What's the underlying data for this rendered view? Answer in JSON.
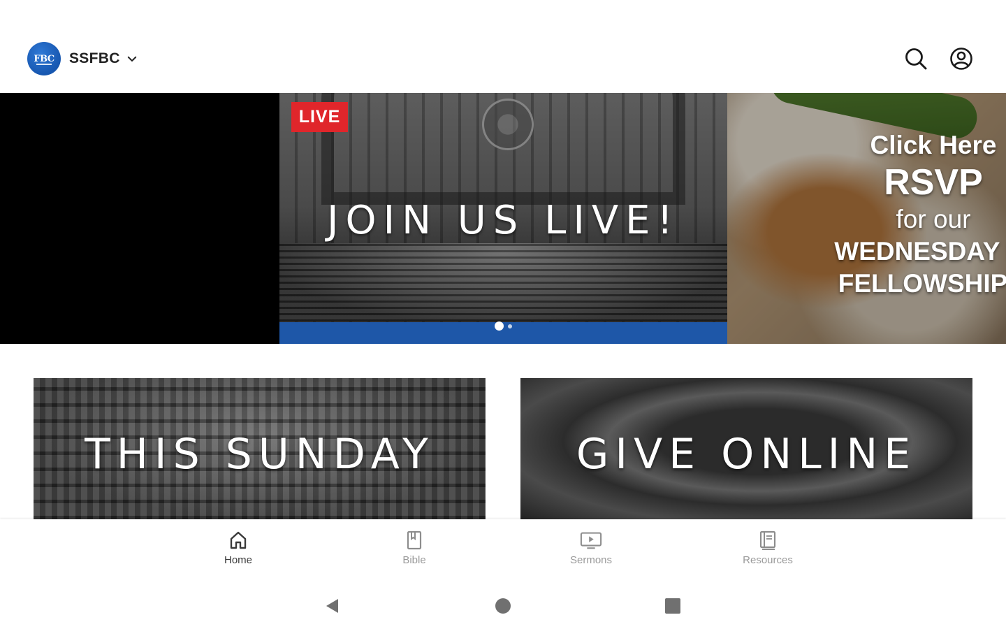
{
  "header": {
    "org_logo_text": "FBC",
    "org_name": "SSFBC",
    "icons": {
      "org_switch": "chevron-down-icon",
      "search": "search-icon",
      "account": "account-circle-icon"
    }
  },
  "carousel": {
    "main_slide": {
      "badge": "LIVE",
      "title": "JOIN US LIVE!"
    },
    "next_slide": {
      "line1": "Click Here",
      "line2": "RSVP",
      "line3": "for our",
      "line4": "WEDNESDAY N",
      "line5": "FELLOWSHIP I"
    },
    "dots": {
      "count": 2,
      "active_index": 0
    }
  },
  "tiles": [
    {
      "title": "THIS SUNDAY"
    },
    {
      "title": "GIVE ONLINE"
    }
  ],
  "bottom_nav": {
    "items": [
      {
        "label": "Home",
        "icon": "home-icon",
        "active": true
      },
      {
        "label": "Bible",
        "icon": "bible-icon",
        "active": false
      },
      {
        "label": "Sermons",
        "icon": "sermons-tv-icon",
        "active": false
      },
      {
        "label": "Resources",
        "icon": "resources-book-icon",
        "active": false
      }
    ]
  },
  "system_nav": {
    "icons": [
      "back-triangle-icon",
      "home-circle-icon",
      "recents-square-icon"
    ]
  },
  "colors": {
    "brand_blue": "#1e57a8",
    "live_red": "#e0262b",
    "nav_active": "#3a3a3a",
    "nav_inactive": "#9a9a9a"
  }
}
